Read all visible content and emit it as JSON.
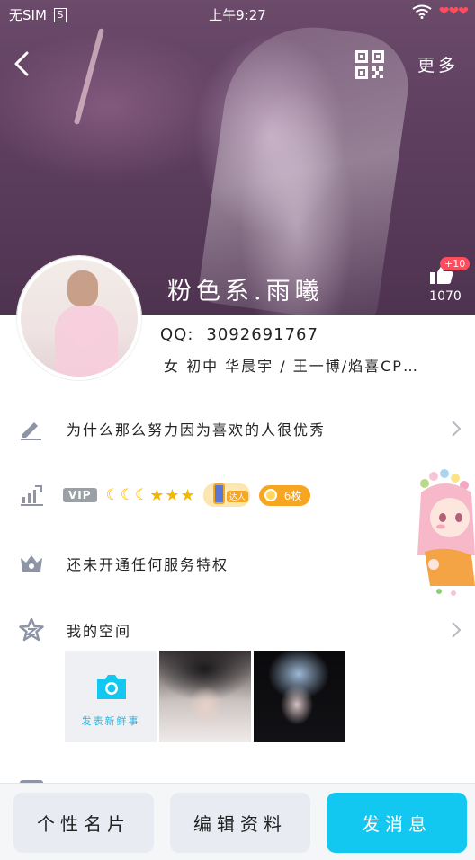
{
  "status_bar": {
    "carrier": "无SIM",
    "s_badge": "S",
    "time": "上午9:27",
    "hearts": "❤❤❤"
  },
  "header": {
    "more_label": "更多"
  },
  "profile": {
    "nickname": "粉色系.雨曦",
    "like_badge": "+10",
    "like_count": "1070",
    "qq_label": "QQ:",
    "qq_number": "3092691767",
    "tags": "女  初中  华晨宇 / 王一博/焰喜CP…"
  },
  "rows": {
    "signature": "为什么那么努力因为喜欢的人很优秀",
    "vip_tag": "VIP",
    "moons": "☾☾☾",
    "stars": "★★★",
    "daren_label": "达人",
    "coin_label": "6枚",
    "service": "还未开通任何服务特权",
    "qzone": "我的空间"
  },
  "photos": {
    "publish_label": "发表新鲜事"
  },
  "buttons": {
    "card": "个性名片",
    "edit": "编辑资料",
    "message": "发消息"
  },
  "colors": {
    "accent": "#12c7f0",
    "gold": "#f5b700",
    "badge_red": "#ff4d5e",
    "icon_gray": "#8d94a6"
  }
}
